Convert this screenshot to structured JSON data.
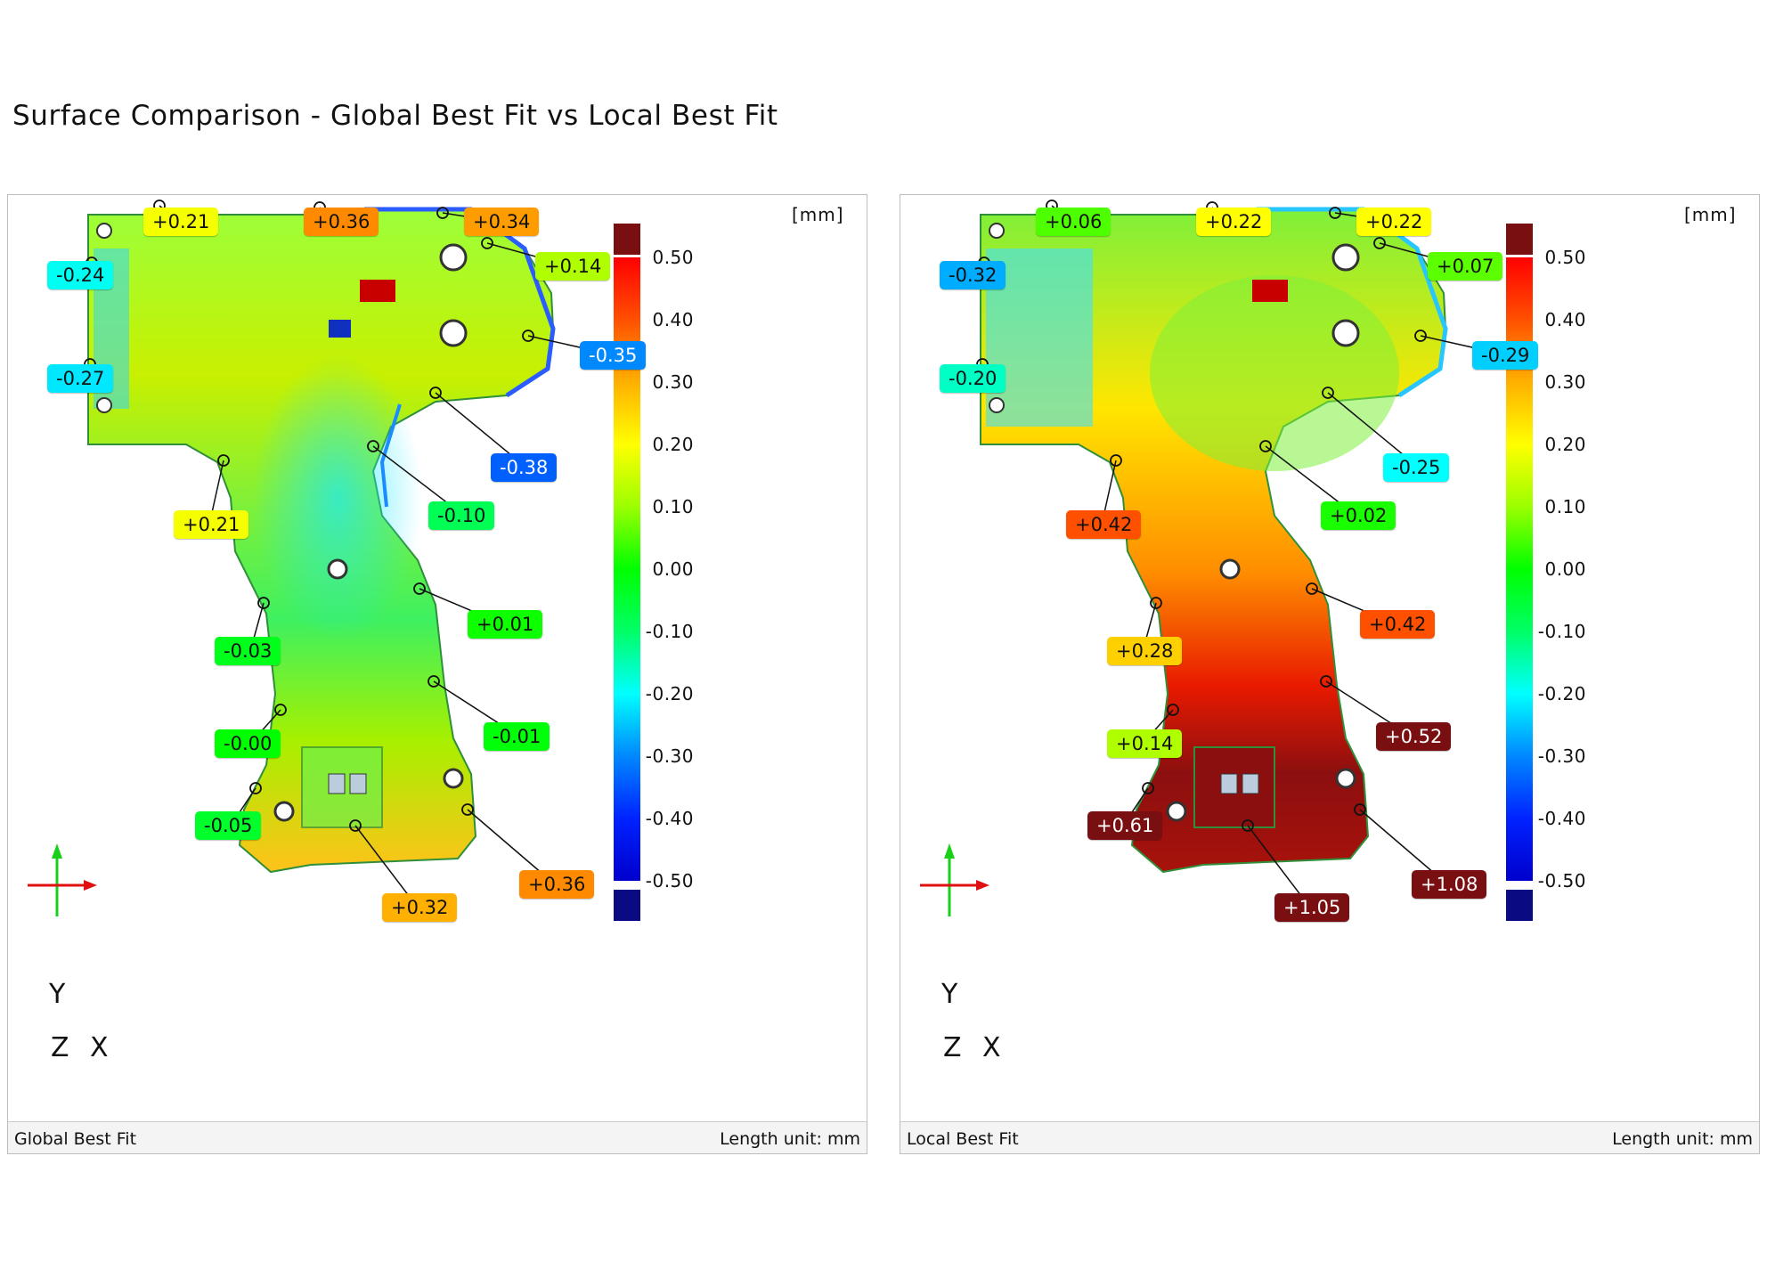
{
  "title": "Surface Comparison - Global Best Fit vs Local Best Fit",
  "colors": {
    "scale": [
      "#0a0a82",
      "#0000ff",
      "#0088ff",
      "#00ffff",
      "#00ff66",
      "#00ff00",
      "#9cff00",
      "#ffff00",
      "#ffb000",
      "#ff5000",
      "#ff0000",
      "#7a0f12"
    ],
    "over_max": "#7a0f12",
    "under_min": "#0a0a82"
  },
  "icons": {
    "axis_triad": "xyz-axis-icon",
    "probe_point": "circle-marker-icon"
  },
  "colorbar": {
    "unit_label": "[mm]",
    "ticks": [
      "0.50",
      "0.40",
      "0.30",
      "0.20",
      "0.10",
      "0.00",
      "-0.10",
      "-0.20",
      "-0.30",
      "-0.40",
      "-0.50"
    ]
  },
  "axes": {
    "y": "Y",
    "z": "Z",
    "x": "X"
  },
  "panels": [
    {
      "name": "Global Best Fit",
      "footer_left": "Global Best Fit",
      "footer_right": "Length unit: mm",
      "labels": [
        {
          "text": "+0.21",
          "value": 0.21
        },
        {
          "text": "+0.36",
          "value": 0.36
        },
        {
          "text": "+0.34",
          "value": 0.34
        },
        {
          "text": "+0.14",
          "value": 0.14
        },
        {
          "text": "-0.24",
          "value": -0.24
        },
        {
          "text": "-0.27",
          "value": -0.27
        },
        {
          "text": "-0.35",
          "value": -0.35
        },
        {
          "text": "-0.38",
          "value": -0.38
        },
        {
          "text": "+0.21",
          "value": 0.21
        },
        {
          "text": "-0.10",
          "value": -0.1
        },
        {
          "text": "+0.01",
          "value": 0.01
        },
        {
          "text": "-0.03",
          "value": -0.03
        },
        {
          "text": "-0.00",
          "value": -0.0
        },
        {
          "text": "-0.01",
          "value": -0.01
        },
        {
          "text": "-0.05",
          "value": -0.05
        },
        {
          "text": "+0.36",
          "value": 0.36
        },
        {
          "text": "+0.32",
          "value": 0.32
        }
      ]
    },
    {
      "name": "Local Best Fit",
      "footer_left": "Local Best Fit",
      "footer_right": "Length unit: mm",
      "labels": [
        {
          "text": "+0.06",
          "value": 0.06
        },
        {
          "text": "+0.22",
          "value": 0.22
        },
        {
          "text": "+0.22",
          "value": 0.22
        },
        {
          "text": "+0.07",
          "value": 0.07
        },
        {
          "text": "-0.32",
          "value": -0.32
        },
        {
          "text": "-0.20",
          "value": -0.2
        },
        {
          "text": "-0.29",
          "value": -0.29
        },
        {
          "text": "-0.25",
          "value": -0.25
        },
        {
          "text": "+0.42",
          "value": 0.42
        },
        {
          "text": "+0.02",
          "value": 0.02
        },
        {
          "text": "+0.42",
          "value": 0.42
        },
        {
          "text": "+0.28",
          "value": 0.28
        },
        {
          "text": "+0.14",
          "value": 0.14
        },
        {
          "text": "+0.52",
          "value": 0.52
        },
        {
          "text": "+0.61",
          "value": 0.61
        },
        {
          "text": "+1.08",
          "value": 1.08
        },
        {
          "text": "+1.05",
          "value": 1.05
        }
      ]
    }
  ]
}
